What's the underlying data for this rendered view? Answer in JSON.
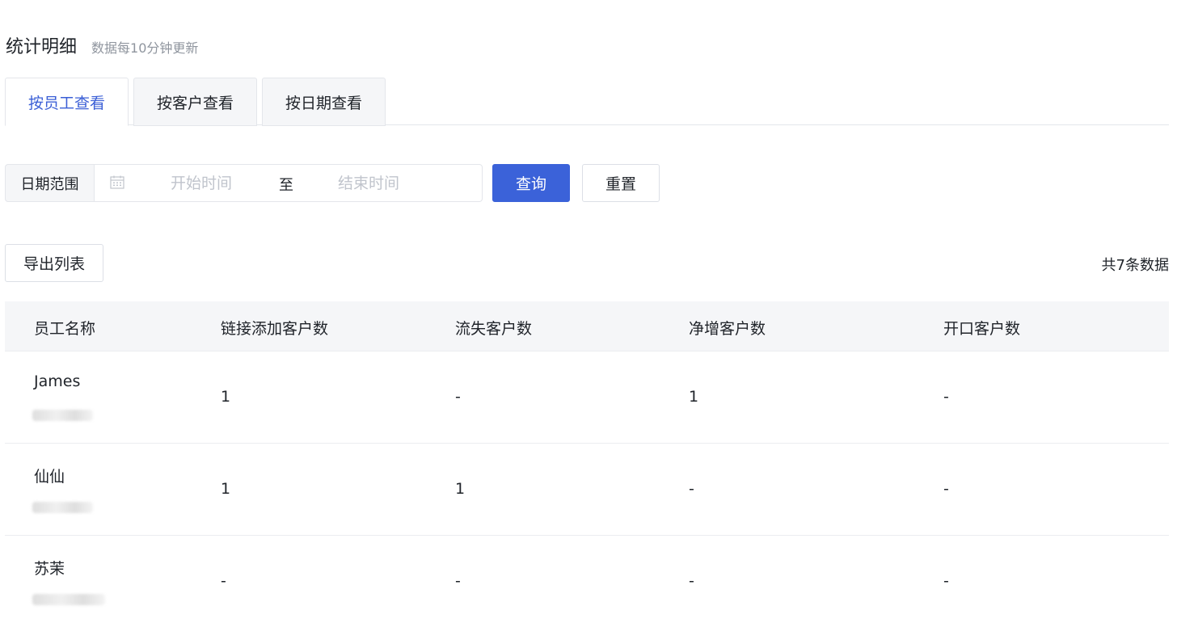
{
  "header": {
    "title": "统计明细",
    "subtitle": "数据每10分钟更新"
  },
  "tabs": [
    {
      "label": "按员工查看",
      "active": true
    },
    {
      "label": "按客户查看",
      "active": false
    },
    {
      "label": "按日期查看",
      "active": false
    }
  ],
  "filter": {
    "range_label": "日期范围",
    "start_placeholder": "开始时间",
    "separator": "至",
    "end_placeholder": "结束时间",
    "search_button": "查询",
    "reset_button": "重置",
    "calendar_icon": "calendar-icon"
  },
  "toolbar": {
    "export_button": "导出列表",
    "total_text": "共7条数据"
  },
  "table": {
    "columns": [
      "员工名称",
      "链接添加客户数",
      "流失客户数",
      "净增客户数",
      "开口客户数"
    ],
    "rows": [
      {
        "name": "James",
        "added": "1",
        "lost": "-",
        "net": "1",
        "opened": "-"
      },
      {
        "name": "仙仙",
        "added": "1",
        "lost": "1",
        "net": "-",
        "opened": "-"
      },
      {
        "name": "苏茉",
        "added": "-",
        "lost": "-",
        "net": "-",
        "opened": "-"
      }
    ]
  },
  "colors": {
    "primary": "#3b62d9",
    "active_tab_text": "#3b5fd6",
    "header_bg": "#f5f6f8"
  }
}
